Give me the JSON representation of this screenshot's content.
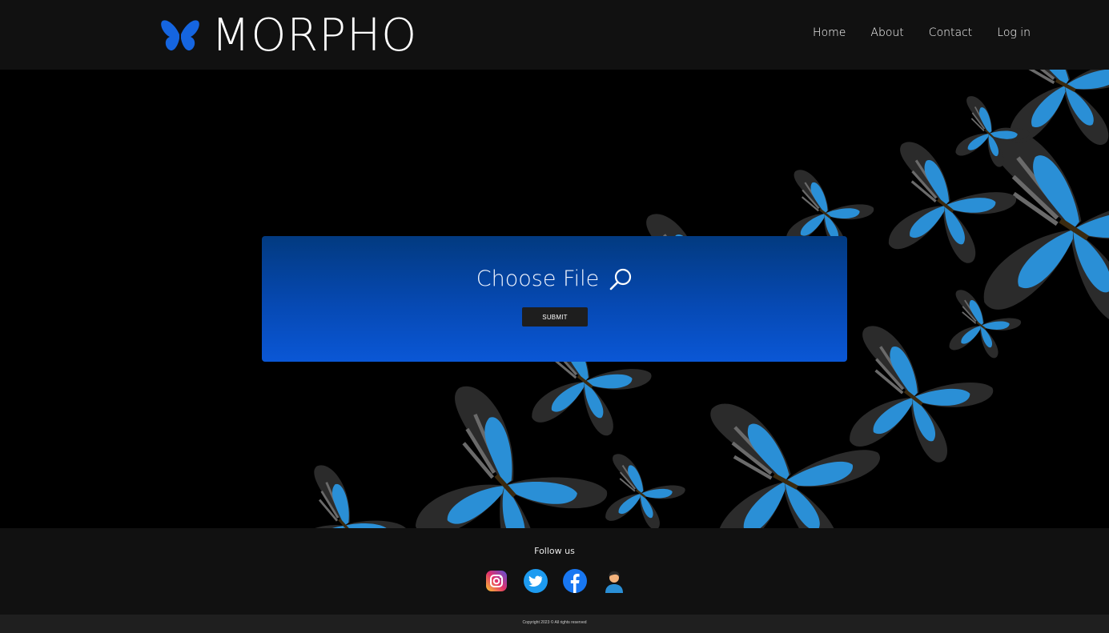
{
  "brand": {
    "name": "MORPHO",
    "logo_icon": "butterfly-icon",
    "accent": "#1565e0"
  },
  "nav": {
    "items": [
      "Home",
      "About",
      "Contact",
      "Log in"
    ]
  },
  "upload": {
    "choose_label": "Choose File",
    "search_icon": "search-icon",
    "submit_label": "SUBMIT",
    "panel_colors": [
      "#023a80",
      "#0a57d6"
    ]
  },
  "footer": {
    "follow_label": "Follow us",
    "socials": [
      "instagram-icon",
      "twitter-icon",
      "facebook-icon",
      "profile-icon"
    ],
    "copyright": "Copyright 2023 © All rights reserved"
  },
  "colors": {
    "header_bg": "#111111",
    "hero_bg": "#000000",
    "butterfly_blue": "#2a8fd6",
    "butterfly_dark": "#2b2b2b"
  }
}
